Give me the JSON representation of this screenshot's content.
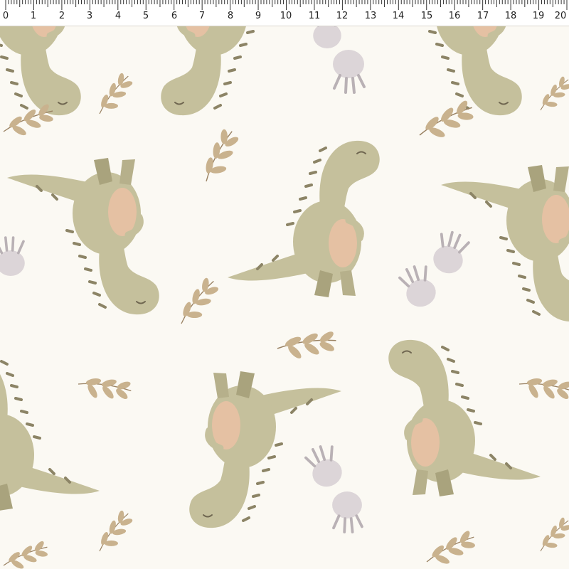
{
  "ruler": {
    "labels": [
      "0",
      "1",
      "2",
      "3",
      "4",
      "5",
      "6",
      "7",
      "8",
      "9",
      "10",
      "11",
      "12",
      "13",
      "14",
      "15",
      "16",
      "17",
      "18",
      "19",
      "20"
    ]
  },
  "colors": {
    "background": "#fbf9f3",
    "dino_body": "#c5c09c",
    "dino_shade": "#a9a37d",
    "dino_stripe": "#8c8466",
    "dino_belly": "#efc2a6",
    "leaf": "#c9b28e",
    "leaf_vein": "#9a8263",
    "footprint": "#dcd5d8"
  },
  "icons": [
    "dinosaur-icon",
    "leaf-sprig-icon",
    "footprint-icon"
  ]
}
